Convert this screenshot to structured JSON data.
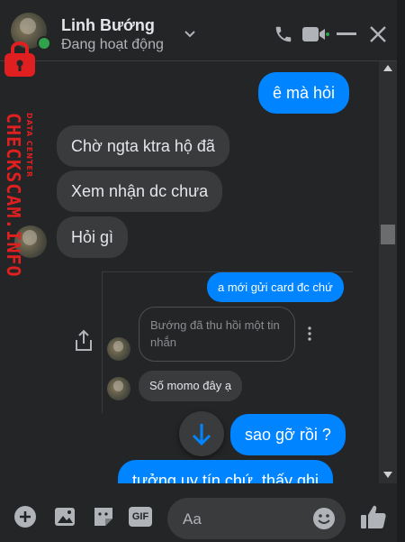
{
  "header": {
    "name": "Linh Bướng",
    "status": "Đang hoạt động"
  },
  "messages": [
    {
      "dir": "out",
      "text": "ê mà hỏi"
    },
    {
      "dir": "in",
      "text": "Chờ ngta ktra hộ đã"
    },
    {
      "dir": "in",
      "text": "Xem nhận dc chưa"
    },
    {
      "dir": "in",
      "text": "Hỏi gì"
    },
    {
      "dir": "out",
      "text": "a mới gửi card đc chứ"
    },
    {
      "dir": "in",
      "text": "Bướng đã thu hồi một tin nhắn",
      "unsent": true
    },
    {
      "dir": "in",
      "text": "Số momo đây ạ"
    },
    {
      "dir": "out",
      "text": "sao gỡ rồi ?"
    },
    {
      "dir": "out",
      "text": "tưởng uy tín chứ, thấy ghi"
    }
  ],
  "composer": {
    "placeholder": "Aa",
    "gif_label": "GIF"
  },
  "watermark": {
    "main": "CHECKSCAM.INFO",
    "sub": "DATA CENTER"
  },
  "colors": {
    "outgoing": "#0084ff",
    "incoming": "#3a3b3c",
    "accent": "#0084ff",
    "background": "#242526"
  }
}
